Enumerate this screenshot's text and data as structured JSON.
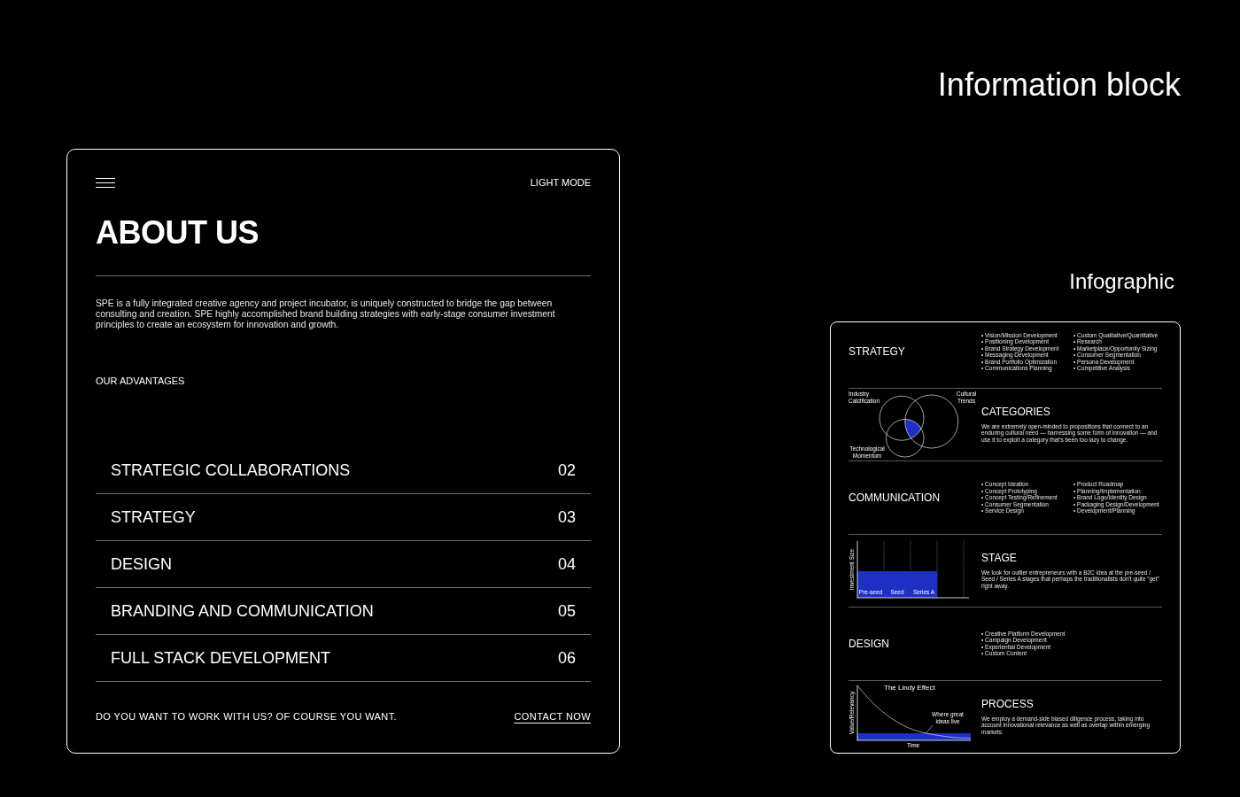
{
  "header": {
    "title": "Information block",
    "subtitle": "Infographic"
  },
  "about_card": {
    "mode_toggle": "LIGHT MODE",
    "title": "ABOUT US",
    "intro": "SPE is a fully integrated creative agency and project incubator, is uniquely constructed to bridge the gap between consulting and creation. SPE highly accomplished brand building strategies with early-stage consumer investment principles to create an ecosystem for innovation and growth.",
    "section_label": "OUR ADVANTAGES",
    "advantages": [
      {
        "label": "STRATEGIC COLLABORATIONS",
        "number": "02"
      },
      {
        "label": "STRATEGY",
        "number": "03"
      },
      {
        "label": "DESIGN",
        "number": "04"
      },
      {
        "label": "BRANDING AND COMMUNICATION",
        "number": "05"
      },
      {
        "label": "FULL STACK DEVELOPMENT",
        "number": "06"
      }
    ],
    "footer": {
      "prompt": "DO YOU WANT TO WORK WITH US? OF COURSE YOU WANT.",
      "link": "CONTACT NOW"
    }
  },
  "infographic": {
    "rows": [
      {
        "kind": "bullets",
        "title": "STRATEGY",
        "columns": [
          [
            "• Vision/Mission Development",
            "• Positioning Development",
            "• Brand Strategy Development",
            "• Messaging Development",
            "• Brand Portfolio Optimization",
            "• Communications Planning"
          ],
          [
            "• Custom Qualitative/Quantitative",
            "• Research",
            "• Marketplace/Opportunity Sizing",
            "• Consumer Segmentation",
            "• Persona Development",
            "• Competitive Analysis"
          ]
        ]
      },
      {
        "kind": "venn",
        "title": "CATEGORIES",
        "text": "We are extremely open-minded to propositions that connect to an enduring cultural need — harnessing some form of innovation — and use it to exploit a category that's been too lazy to change.",
        "labels": [
          "Industry Calcification",
          "Cultural Trends",
          "Technological Momentum"
        ]
      },
      {
        "kind": "bullets",
        "title": "COMMUNICATION",
        "columns": [
          [
            "• Concept Ideation",
            "• Concept Prototyping",
            "• Concept Testing/Refinement",
            "• Consumer Segmentation",
            "• Service Design"
          ],
          [
            "• Product Roadmap",
            "• Planning/Implementation",
            "• Brand Logo/Identity Design",
            "• Packaging Design/Development",
            "• Development/Planning"
          ]
        ]
      },
      {
        "kind": "stage",
        "title": "STAGE",
        "text": "We look for outlier entrepreneurs with a B2C idea at the pre-seed / Seed / Series A stages that perhaps the traditionalists don't quite “get” right away.",
        "ylabel": "Investment Size",
        "bars": [
          "Pre-seed",
          "Seed",
          "Series A"
        ]
      },
      {
        "kind": "bullets",
        "title": "DESIGN",
        "columns": [
          [
            "• Creative Platform Development",
            "• Campaign Development",
            "• Experiential Development",
            "• Custom Content"
          ]
        ]
      },
      {
        "kind": "lindy",
        "title": "PROCESS",
        "text": "We employ a demand-side biased diligence process, taking into account innovational relevance as well as overlap within emerging markets.",
        "chart_title": "The Lindy Effect",
        "ylabel": "Value/Relevancy",
        "xlabel": "Time",
        "annotation": "Where great ideas live"
      }
    ]
  }
}
